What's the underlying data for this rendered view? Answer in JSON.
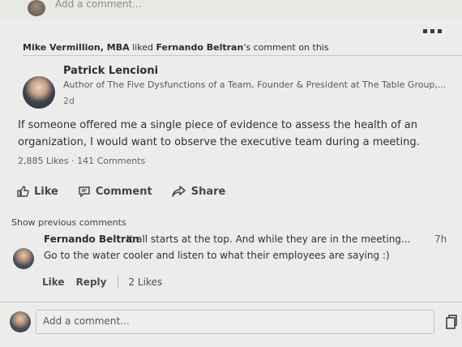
{
  "top": {
    "placeholder": "Add a comment..."
  },
  "activity": {
    "actor": "Mike Vermillion, MBA",
    "verb": " liked ",
    "target": "Fernando Beltran",
    "suffix": "'s comment on this"
  },
  "post": {
    "author_name": "Patrick Lencioni",
    "author_headline": "Author of The Five Dysfunctions of a Team, Founder & President at The Table Group,...",
    "time": "2d",
    "body": "If someone offered me a single piece of evidence to assess the health of an organization, I would want to observe the executive team during a meeting.",
    "stats": "2,885 Likes · 141 Comments"
  },
  "actions": {
    "like": "Like",
    "comment": "Comment",
    "share": "Share"
  },
  "comments": {
    "show_previous": "Show previous comments",
    "items": [
      {
        "author": "Fernando Beltran",
        "text_line1": "It all starts at the top. And while they are in the meeting...",
        "text_line2": "Go to the water cooler and listen to what their employees are saying :)",
        "time": "7h",
        "like": "Like",
        "reply": "Reply",
        "likes_count": "2 Likes"
      }
    ]
  },
  "composer": {
    "placeholder": "Add a comment..."
  }
}
